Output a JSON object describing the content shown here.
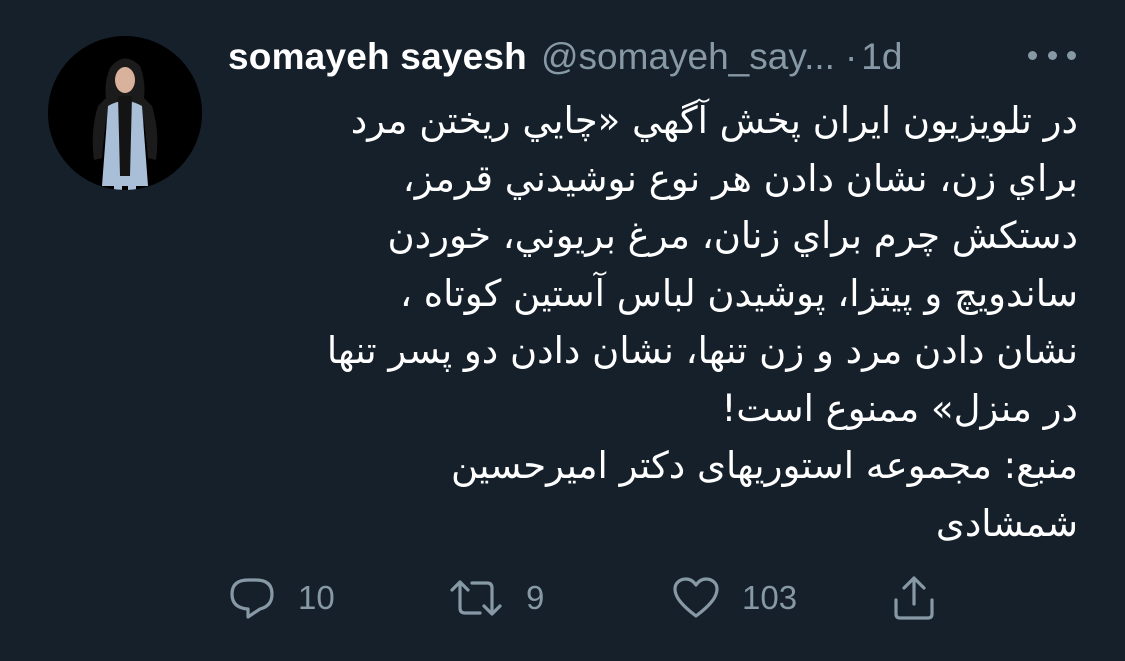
{
  "tweet": {
    "author": {
      "display_name": "somayeh sayesh",
      "handle": "@somayeh_say...",
      "separator": "·",
      "time": "1d"
    },
    "text_lines": [
      "در تلویزیون ایران پخش آگهي «چايي ريختن مرد",
      "براي زن، نشان دادن هر نوع نوشيدني قرمز،",
      "دستكش چرم براي زنان، مرغ بريوني، خوردن",
      "ساندويچ و پيتزا، پوشيدن لباس آستين كوتاه ،",
      "نشان دادن مرد و زن تنها، نشان دادن دو پسر تنها",
      "در منزل» ممنوع است!",
      "منبع: مجموعه استوريهای دکتر اميرحسين",
      "شمشادی"
    ],
    "actions": {
      "reply": {
        "icon": "reply-icon",
        "count": "10"
      },
      "retweet": {
        "icon": "retweet-icon",
        "count": "9"
      },
      "like": {
        "icon": "heart-icon",
        "count": "103"
      },
      "share": {
        "icon": "share-icon"
      }
    }
  },
  "colors": {
    "background": "#15202b",
    "primary_text": "#ffffff",
    "secondary_text": "#8899a6"
  }
}
